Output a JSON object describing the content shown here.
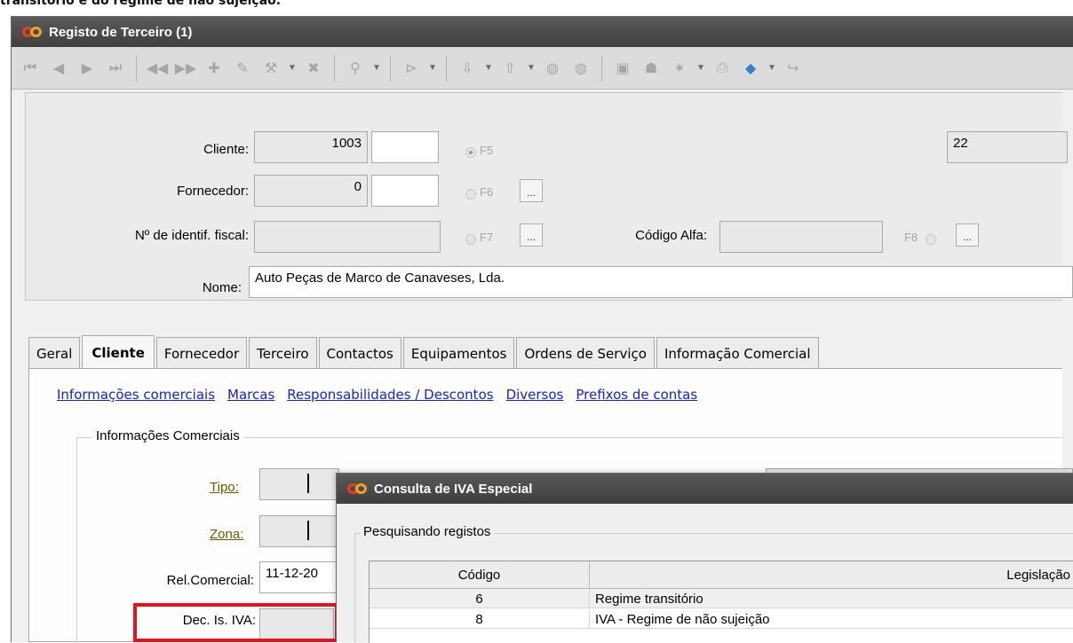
{
  "caption": "transitório e do regime de não sujeição.",
  "window": {
    "title": "Registo de Terceiro (1)"
  },
  "header": {
    "cliente_label": "Cliente:",
    "cliente_value": "1003",
    "cliente_key": "F5",
    "fornecedor_label": "Fornecedor:",
    "fornecedor_value": "0",
    "fornecedor_key": "F6",
    "nif_label": "Nº de identif. fiscal:",
    "nif_key": "F7",
    "codigo_alfa_label": "Código Alfa:",
    "codigo_alfa_key": "F8",
    "top_right_value": "22",
    "nome_label": "Nome:",
    "nome_value": "Auto Peças de Marco de Canaveses, Lda.",
    "ellipsis": "..."
  },
  "tabs": [
    {
      "label": "Geral"
    },
    {
      "label": "Cliente",
      "active": true
    },
    {
      "label": "Fornecedor"
    },
    {
      "label": "Terceiro"
    },
    {
      "label": "Contactos"
    },
    {
      "label": "Equipamentos"
    },
    {
      "label": "Ordens de Serviço"
    },
    {
      "label": "Informação Comercial"
    }
  ],
  "links": [
    "Informações comerciais",
    "Marcas",
    "Responsabilidades / Descontos",
    "Diversos",
    "Prefixos de contas"
  ],
  "informacoes_comerciais": {
    "title": "Informações Comerciais",
    "tipo_label": "Tipo:",
    "zona_label": "Zona:",
    "rel_label": "Rel.Comercial:",
    "rel_value": "11-12-20",
    "dec_label": "Dec. Is. IVA:"
  },
  "dialog": {
    "title": "Consulta de IVA Especial",
    "group_title": "Pesquisando registos",
    "columns": [
      "Código",
      "Legislação"
    ],
    "rows": [
      {
        "codigo": "6",
        "legislacao": "Regime transitório"
      },
      {
        "codigo": "8",
        "legislacao": "IVA - Regime de não sujeição"
      }
    ]
  },
  "colors": {
    "highlight": "#e3141d",
    "link": "#1a22c8",
    "titlebar": "#4a4a4a"
  }
}
